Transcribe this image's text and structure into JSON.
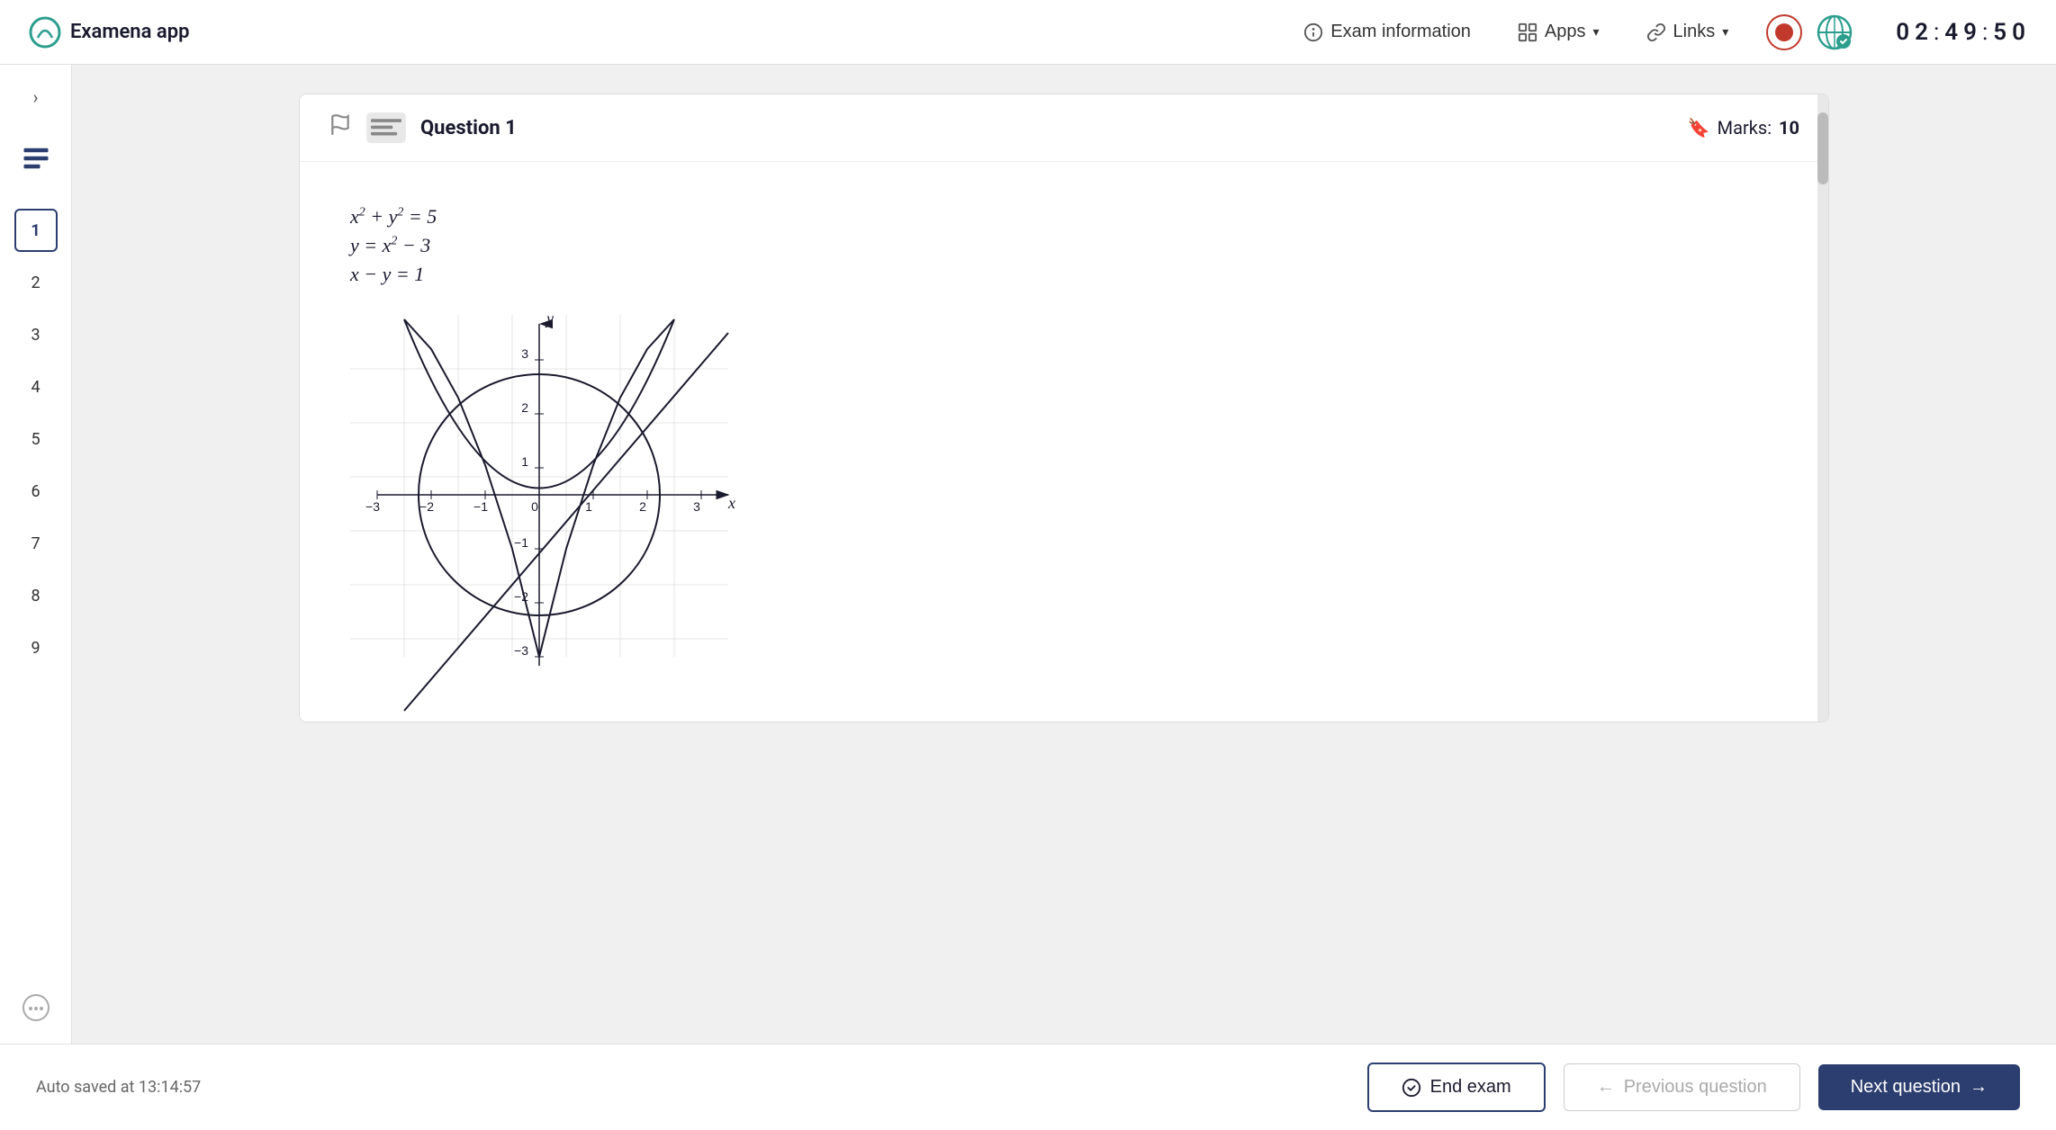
{
  "header": {
    "app_title": "Examena app",
    "exam_info_label": "Exam information",
    "apps_label": "Apps",
    "links_label": "Links",
    "timer": {
      "d1": "0",
      "d2": "2",
      "colon1": ":",
      "d3": "4",
      "d4": "9",
      "colon2": ":",
      "d5": "5",
      "d6": "0"
    }
  },
  "sidebar": {
    "toggle_label": "›",
    "question_numbers": [
      "1",
      "2",
      "3",
      "4",
      "5",
      "6",
      "7",
      "8",
      "9"
    ],
    "active_question": "1"
  },
  "question": {
    "title": "Question 1",
    "marks_label": "Marks:",
    "marks_value": "10",
    "equations": [
      "x² + y² = 5",
      "y = x² − 3",
      "x − y = 1"
    ]
  },
  "bottom_bar": {
    "auto_saved": "Auto saved at 13:14:57",
    "end_exam_label": "End exam",
    "prev_label": "Previous question",
    "next_label": "Next question"
  },
  "colors": {
    "primary": "#2c3e70",
    "accent": "#c0392b",
    "bg": "#f0f0f0",
    "white": "#ffffff",
    "text": "#1a1a2e"
  }
}
